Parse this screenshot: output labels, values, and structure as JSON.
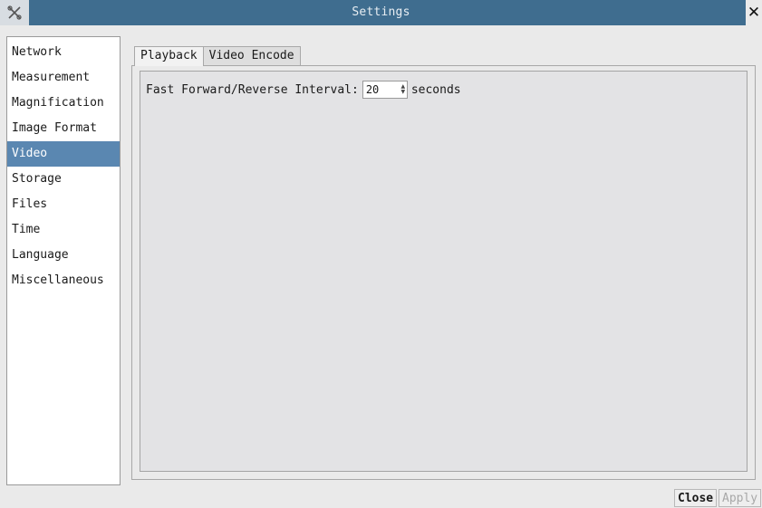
{
  "window": {
    "title": "Settings",
    "app_icon": "tools-icon",
    "close_glyph": "✕"
  },
  "sidebar": {
    "selected_index": 4,
    "items": [
      {
        "label": "Network"
      },
      {
        "label": "Measurement"
      },
      {
        "label": "Magnification"
      },
      {
        "label": "Image Format"
      },
      {
        "label": "Video"
      },
      {
        "label": "Storage"
      },
      {
        "label": "Files"
      },
      {
        "label": "Time"
      },
      {
        "label": "Language"
      },
      {
        "label": "Miscellaneous"
      }
    ]
  },
  "tabs": [
    {
      "label": "Playback",
      "active": true
    },
    {
      "label": "Video Encode",
      "active": false
    }
  ],
  "playback": {
    "interval_label": "Fast Forward/Reverse Interval:",
    "interval_value": "20",
    "interval_unit": "seconds"
  },
  "footer": {
    "close_label": "Close",
    "apply_label": "Apply"
  },
  "colors": {
    "titlebar": "#3f6d8f",
    "selection": "#5a87b1"
  }
}
